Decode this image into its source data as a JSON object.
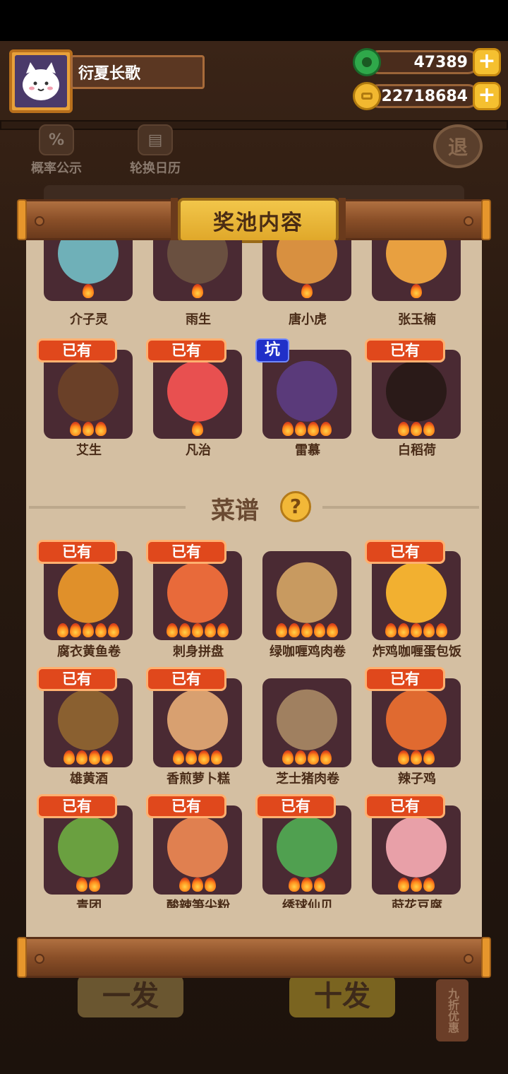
{
  "player": {
    "name": "衍夏长歌"
  },
  "currencies": [
    {
      "icon": "jade-coin-icon",
      "value": "47389",
      "color": "#2fa84a"
    },
    {
      "icon": "gold-coin-icon",
      "value": "22718684",
      "color": "#f2b830"
    }
  ],
  "side_buttons": {
    "probability": "概率公示",
    "calendar": "轮换日历",
    "exit": "退"
  },
  "bottom": {
    "single": "一发",
    "ten": "十发",
    "discount": "九折优惠"
  },
  "panel": {
    "title": "奖池内容",
    "owned_label": "已有",
    "pit_label": "坑",
    "characters_partial": [
      {
        "name": "介子灵",
        "color": "#6fb0b8"
      },
      {
        "name": "雨生",
        "color": "#6a5040"
      },
      {
        "name": "唐小虎",
        "color": "#d89040"
      },
      {
        "name": "张玉楠",
        "color": "#e8a040"
      }
    ],
    "characters": [
      {
        "name": "艾生",
        "badge": "owned",
        "stars": 3,
        "color": "#6a4028"
      },
      {
        "name": "凡治",
        "badge": "owned",
        "stars": 1,
        "color": "#e85050"
      },
      {
        "name": "雷慕",
        "badge": "pit",
        "stars": 4,
        "color": "#5a3a7a"
      },
      {
        "name": "白稻荷",
        "badge": "owned",
        "stars": 3,
        "color": "#2a1a18"
      }
    ],
    "recipes_section": {
      "title": "菜谱",
      "help": "?"
    },
    "recipes": [
      {
        "name": "腐衣黄鱼卷",
        "owned": true,
        "stars": 5,
        "color": "#e0902a"
      },
      {
        "name": "刺身拼盘",
        "owned": true,
        "stars": 5,
        "color": "#e86a3a"
      },
      {
        "name": "绿咖喱鸡肉卷",
        "owned": false,
        "stars": 5,
        "color": "#c89a60"
      },
      {
        "name": "炸鸡咖喱蛋包饭",
        "owned": true,
        "stars": 5,
        "color": "#f2b030"
      },
      {
        "name": "雄黄酒",
        "owned": true,
        "stars": 4,
        "color": "#8a6030"
      },
      {
        "name": "香煎萝卜糕",
        "owned": true,
        "stars": 4,
        "color": "#d8a070"
      },
      {
        "name": "芝士猪肉卷",
        "owned": false,
        "stars": 4,
        "color": "#a08060"
      },
      {
        "name": "辣子鸡",
        "owned": true,
        "stars": 3,
        "color": "#e06a30"
      },
      {
        "name": "青团",
        "owned": true,
        "stars": 2,
        "color": "#6aa040"
      },
      {
        "name": "酸辣笋尖粉",
        "owned": true,
        "stars": 3,
        "color": "#e08050"
      },
      {
        "name": "绣球仙贝",
        "owned": true,
        "stars": 3,
        "color": "#50a050"
      },
      {
        "name": "莳花豆腐",
        "owned": true,
        "stars": 3,
        "color": "#e8a0a8"
      }
    ]
  }
}
